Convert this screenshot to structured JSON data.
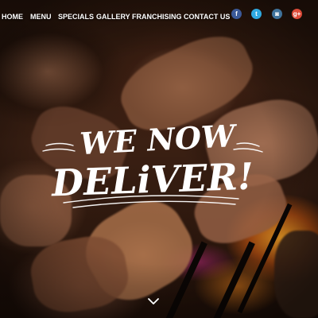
{
  "nav": {
    "items": [
      {
        "label": "HOME"
      },
      {
        "label": "MENU"
      },
      {
        "label": "SPECIALS"
      },
      {
        "label": "GALLERY"
      },
      {
        "label": "FRANCHISING"
      },
      {
        "label": "CONTACT US"
      }
    ],
    "social": [
      {
        "icon": "facebook-icon",
        "glyph": "f",
        "color": "#3b5998"
      },
      {
        "icon": "twitter-icon",
        "glyph": "t",
        "color": "#2fa9e1"
      },
      {
        "icon": "instagram-icon",
        "glyph": "◙",
        "color": "#3f729b"
      },
      {
        "icon": "google-plus-icon",
        "glyph": "g+",
        "color": "#dd4b39"
      }
    ]
  },
  "hero": {
    "headline_line1": "WE NOW",
    "headline_line2": "DELiVER!"
  }
}
